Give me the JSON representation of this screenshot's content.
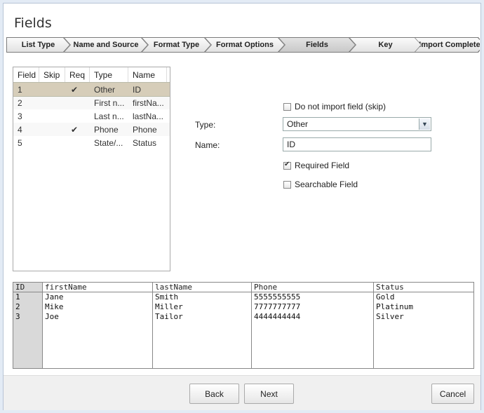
{
  "window": {
    "title": "Fields"
  },
  "wizard_steps": [
    {
      "label": "List Type",
      "active": false
    },
    {
      "label": "Name and Source",
      "active": false
    },
    {
      "label": "Format Type",
      "active": false
    },
    {
      "label": "Format Options",
      "active": false
    },
    {
      "label": "Fields",
      "active": true
    },
    {
      "label": "Key",
      "active": false
    },
    {
      "label": "Import Complete",
      "active": false
    }
  ],
  "field_grid": {
    "headers": [
      "Field",
      "Skip",
      "Req",
      "Type",
      "Name"
    ],
    "rows": [
      {
        "field": "1",
        "skip": "",
        "req": "✔",
        "type": "Other",
        "name": "ID",
        "selected": true
      },
      {
        "field": "2",
        "skip": "",
        "req": "",
        "type": "First n...",
        "name": "firstNa...",
        "selected": false
      },
      {
        "field": "3",
        "skip": "",
        "req": "",
        "type": "Last n...",
        "name": "lastNa...",
        "selected": false
      },
      {
        "field": "4",
        "skip": "",
        "req": "✔",
        "type": "Phone",
        "name": "Phone",
        "selected": false
      },
      {
        "field": "5",
        "skip": "",
        "req": "",
        "type": "State/...",
        "name": "Status",
        "selected": false
      }
    ]
  },
  "options": {
    "skip_label": "Do not import field (skip)",
    "skip_checked": false,
    "type_label": "Type:",
    "type_value": "Other",
    "name_label": "Name:",
    "name_value": "ID",
    "required_label": "Required Field",
    "required_checked": true,
    "searchable_label": "Searchable Field",
    "searchable_checked": false
  },
  "preview": {
    "headers": [
      "ID",
      "firstName",
      "lastName",
      "Phone",
      "Status"
    ],
    "rows": [
      [
        "1",
        "Jane",
        "Smith",
        "5555555555",
        "Gold"
      ],
      [
        "2",
        "Mike",
        "Miller",
        "7777777777",
        "Platinum"
      ],
      [
        "3",
        "Joe",
        "Tailor",
        "4444444444",
        "Silver"
      ]
    ]
  },
  "buttons": {
    "back": "Back",
    "next": "Next",
    "cancel": "Cancel"
  },
  "icons": {
    "dropdown": "chevron-down-icon",
    "check": "checkmark-icon"
  }
}
